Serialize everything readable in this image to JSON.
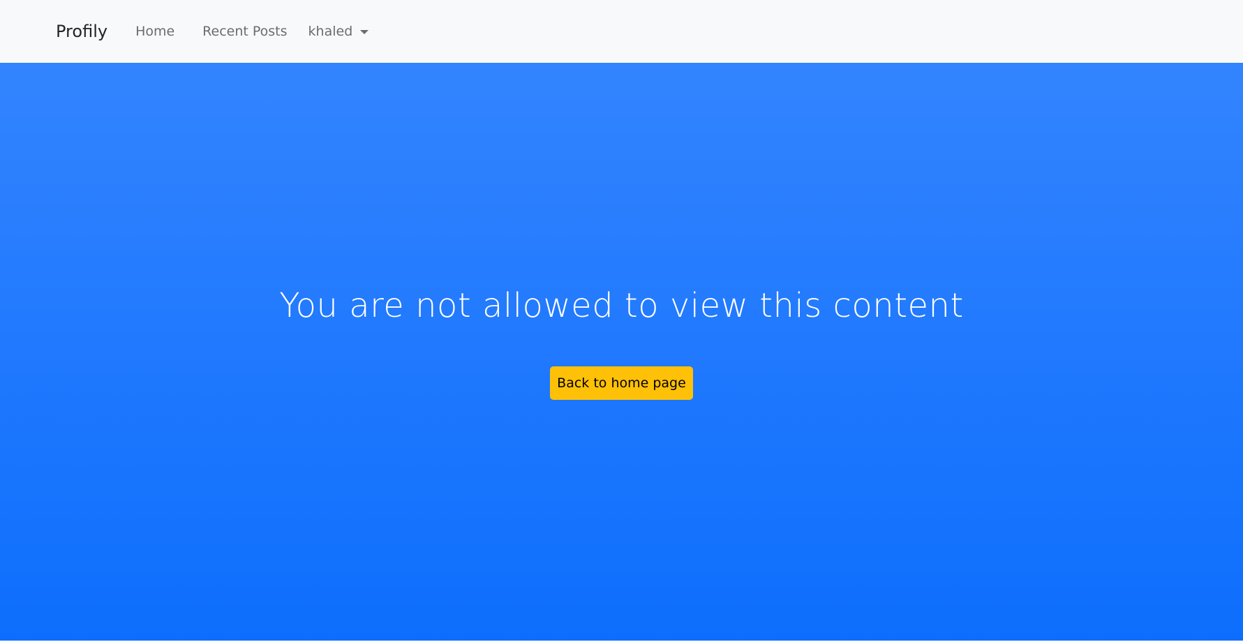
{
  "navbar": {
    "brand": "Profily",
    "links": {
      "home": "Home",
      "recent_posts": "Recent Posts"
    },
    "user_menu": {
      "label": "khaled",
      "icon": "caret-down-icon"
    }
  },
  "hero": {
    "message": "You are not allowed to view this content",
    "button_label": "Back to home page"
  },
  "colors": {
    "navbar_bg": "#f8f9fa",
    "hero_gradient_top": "#3384fe",
    "hero_gradient_bottom": "#0d6efd",
    "button_bg": "#ffc107"
  }
}
